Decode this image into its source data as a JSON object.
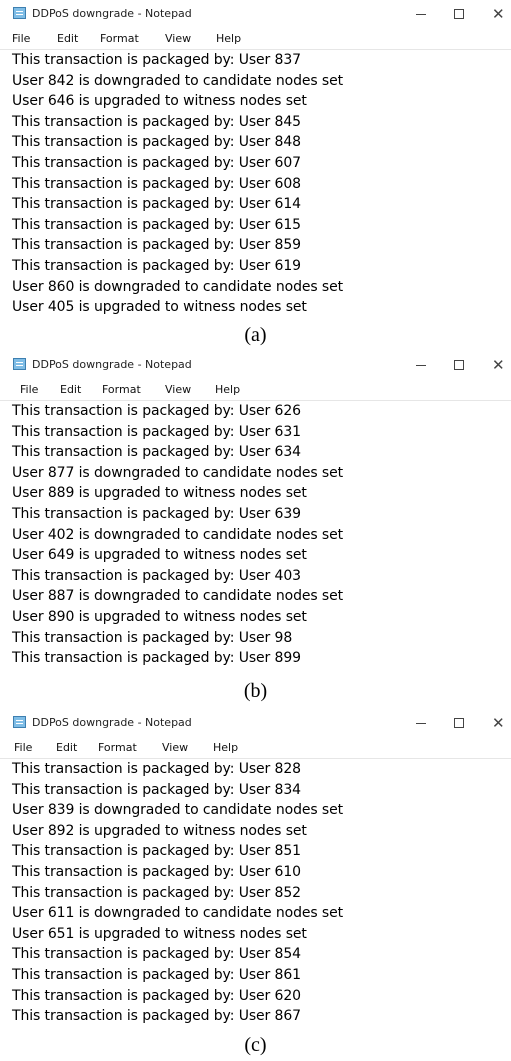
{
  "panels": [
    {
      "window_title": "DDPoS downgrade - Notepad",
      "menu": [
        "File",
        "Edit",
        "Format",
        "View",
        "Help"
      ],
      "caption": "(a)",
      "lines": [
        "This transaction is packaged by: User 837",
        "User 842 is downgraded to candidate nodes set",
        "User 646 is upgraded to witness nodes set",
        "This transaction is packaged by: User 845",
        "This transaction is packaged by: User 848",
        "This transaction is packaged by: User 607",
        "This transaction is packaged by: User 608",
        "This transaction is packaged by: User 614",
        "This transaction is packaged by: User 615",
        "This transaction is packaged by: User 859",
        "This transaction is packaged by: User 619",
        "User 860 is downgraded to candidate nodes set",
        "User 405 is upgraded to witness nodes set"
      ]
    },
    {
      "window_title": "DDPoS downgrade - Notepad",
      "menu": [
        "File",
        "Edit",
        "Format",
        "View",
        "Help"
      ],
      "caption": "(b)",
      "lines": [
        "This transaction is packaged by: User 626",
        "This transaction is packaged by: User 631",
        "This transaction is packaged by: User 634",
        "User 877 is downgraded to candidate nodes set",
        "User 889 is upgraded to witness nodes set",
        "This transaction is packaged by: User 639",
        "User 402 is downgraded to candidate nodes set",
        "User 649 is upgraded to witness nodes set",
        "This transaction is packaged by: User 403",
        "User 887 is downgraded to candidate nodes set",
        "User 890 is upgraded to witness nodes set",
        "This transaction is packaged by: User 98",
        "This transaction is packaged by: User 899"
      ]
    },
    {
      "window_title": "DDPoS downgrade - Notepad",
      "menu": [
        "File",
        "Edit",
        "Format",
        "View",
        "Help"
      ],
      "caption": "(c)",
      "lines": [
        "This transaction is packaged by: User 828",
        "This transaction is packaged by: User 834",
        "User 839 is downgraded to candidate nodes set",
        "User 892 is upgraded to witness nodes set",
        "This transaction is packaged by: User 851",
        "This transaction is packaged by: User 610",
        "This transaction is packaged by: User 852",
        "User 611 is downgraded to candidate nodes set",
        "User 651 is upgraded to witness nodes set",
        "This transaction is packaged by: User 854",
        "This transaction is packaged by: User 861",
        "This transaction is packaged by: User 620",
        "This transaction is packaged by: User 867"
      ]
    }
  ]
}
